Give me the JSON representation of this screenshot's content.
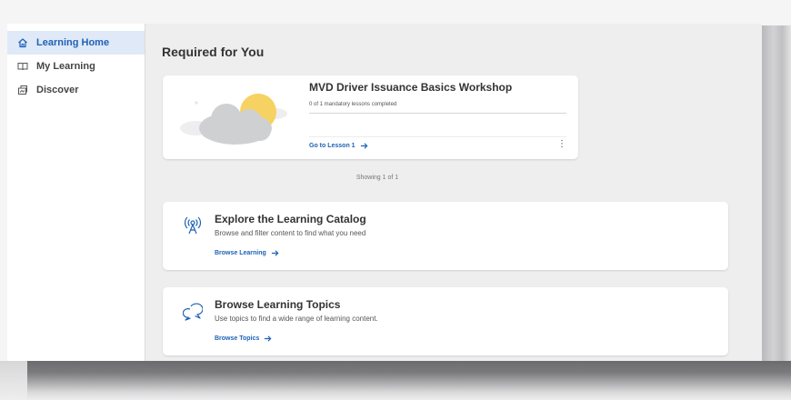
{
  "sidebar": {
    "items": [
      {
        "label": "Learning Home",
        "icon": "home-icon",
        "active": true
      },
      {
        "label": "My Learning",
        "icon": "book-icon",
        "active": false
      },
      {
        "label": "Discover",
        "icon": "discover-icon",
        "active": false
      }
    ]
  },
  "main": {
    "section_title": "Required for You",
    "course": {
      "title": "MVD Driver Issuance Basics Workshop",
      "progress_text": "0 of 1 mandatory lessons completed",
      "progress_fraction": 0,
      "link_label": "Go to Lesson 1",
      "menu_icon": "more-vertical-icon"
    },
    "showing_text": "Showing 1 of 1",
    "catalog": {
      "title": "Explore the Learning Catalog",
      "subtitle": "Browse and filter content to find what you need",
      "link_label": "Browse Learning",
      "icon": "broadcast-tower-icon"
    },
    "topics": {
      "title": "Browse Learning Topics",
      "subtitle": "Use topics to find a wide range of learning content.",
      "link_label": "Browse Topics",
      "icon": "chat-bubbles-icon"
    }
  },
  "colors": {
    "accent": "#1e62b6",
    "active_bg": "#dfe9f7",
    "page_bg": "#eeeeef",
    "sun": "#f6d262",
    "cloud": "#cfd0d2"
  }
}
